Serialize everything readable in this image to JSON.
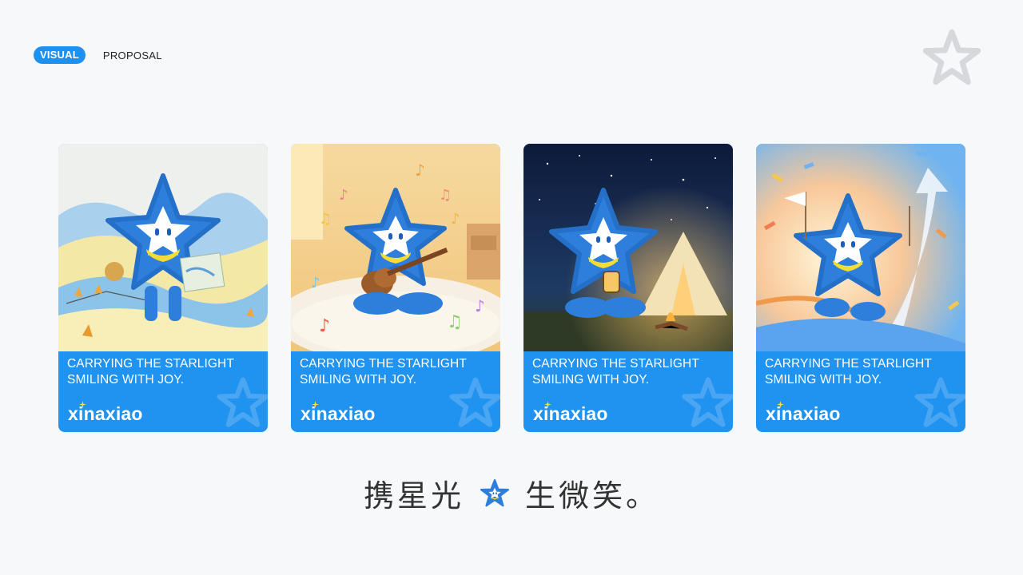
{
  "header": {
    "tag_primary": "VISUAL",
    "tag_secondary": "PROPOSAL"
  },
  "cards": [
    {
      "scene": "map-explorer",
      "caption_line1": "CARRYING THE STARLIGHT",
      "caption_line2": "SMILING WITH JOY.",
      "brand": "xinaxiao"
    },
    {
      "scene": "ukulele-music",
      "caption_line1": "CARRYING THE STARLIGHT",
      "caption_line2": "SMILING WITH JOY.",
      "brand": "xinaxiao"
    },
    {
      "scene": "night-camping",
      "caption_line1": "CARRYING THE STARLIGHT",
      "caption_line2": "SMILING WITH JOY.",
      "brand": "xinaxiao"
    },
    {
      "scene": "celebration-run",
      "caption_line1": "CARRYING THE STARLIGHT",
      "caption_line2": "SMILING WITH JOY.",
      "brand": "xinaxiao"
    }
  ],
  "slogan": {
    "left": "携星光",
    "right": "生微笑。"
  },
  "colors": {
    "accent": "#1e90f0",
    "card_footer": "#1f93ef",
    "mascot": "#2f7fdc",
    "scarf": "#f2dc35"
  },
  "icons": {
    "corner": "star-outline-icon",
    "slogan": "star-mascot-icon",
    "card_watermark": "star-outline-icon"
  }
}
